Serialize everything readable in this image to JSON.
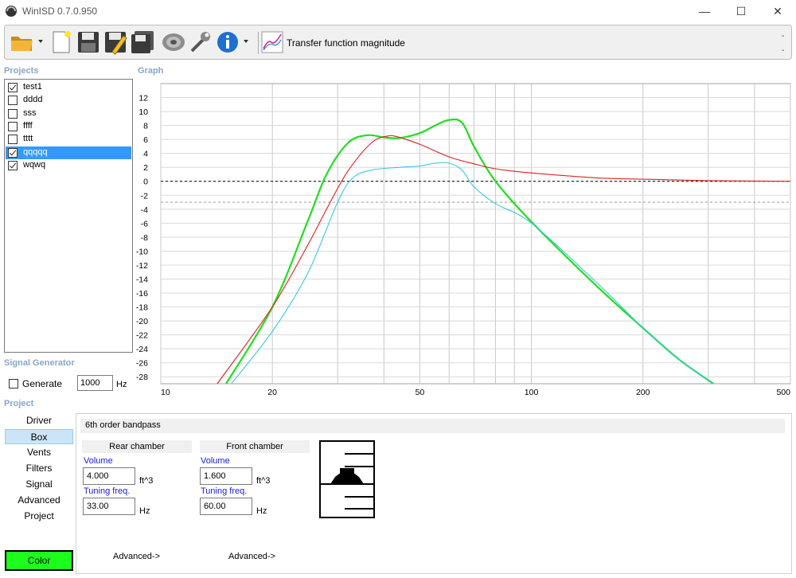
{
  "window": {
    "title": "WinISD 0.7.0.950",
    "min_glyph": "—",
    "max_glyph": "☐",
    "close_glyph": "✕"
  },
  "toolbar": {
    "buttons": [
      "open-folder-icon",
      "new-document-icon",
      "save-icon",
      "save-as-icon",
      "save-all-icon",
      "driver-icon",
      "tools-icon",
      "info-icon",
      "graph-type-icon"
    ],
    "graph_type_label": "Transfer function magnitude",
    "dash_top": "-",
    "dash_bottom": "-"
  },
  "projects": {
    "heading": "Projects",
    "items": [
      {
        "label": "test1",
        "checked": true,
        "selected": false
      },
      {
        "label": "dddd",
        "checked": false,
        "selected": false
      },
      {
        "label": "sss",
        "checked": false,
        "selected": false
      },
      {
        "label": "ffff",
        "checked": false,
        "selected": false
      },
      {
        "label": "tttt",
        "checked": false,
        "selected": false
      },
      {
        "label": "qqqqq",
        "checked": true,
        "selected": true
      },
      {
        "label": "wqwq",
        "checked": true,
        "selected": false
      }
    ]
  },
  "graph": {
    "heading": "Graph"
  },
  "chart_data": {
    "type": "line",
    "title": "Transfer function magnitude",
    "xlabel": "",
    "ylabel": "",
    "x_scale": "log",
    "xlim": [
      10,
      500
    ],
    "ylim": [
      -29,
      14
    ],
    "x_ticks": [
      "10",
      "20",
      "50",
      "100",
      "200",
      "500"
    ],
    "y_ticks": [
      "12",
      "10",
      "8",
      "6",
      "4",
      "2",
      "0",
      "-2",
      "-4",
      "-6",
      "-8",
      "-10",
      "-12",
      "-14",
      "-16",
      "-18",
      "-20",
      "-22",
      "-24",
      "-26",
      "-28"
    ],
    "grid": true,
    "reference_lines": [
      {
        "y": 0,
        "style": "dotted",
        "color": "#000000"
      },
      {
        "y": -3,
        "style": "dotted",
        "color": "#9a9a9a"
      }
    ],
    "series": [
      {
        "color": "#22dd22",
        "points": [
          [
            15,
            -29
          ],
          [
            20,
            -18
          ],
          [
            25,
            -5.5
          ],
          [
            28,
            1
          ],
          [
            32,
            5.5
          ],
          [
            36,
            6.6
          ],
          [
            40,
            6.3
          ],
          [
            44,
            6.2
          ],
          [
            50,
            6.9
          ],
          [
            55,
            8
          ],
          [
            60,
            8.8
          ],
          [
            65,
            8.4
          ],
          [
            70,
            5
          ],
          [
            80,
            0
          ],
          [
            100,
            -5.8
          ],
          [
            150,
            -15
          ],
          [
            200,
            -21
          ],
          [
            250,
            -25.5
          ],
          [
            310,
            -29
          ]
        ]
      },
      {
        "color": "#dd2222",
        "points": [
          [
            14.2,
            -29
          ],
          [
            20,
            -18
          ],
          [
            25,
            -9
          ],
          [
            28,
            -4
          ],
          [
            32,
            1.5
          ],
          [
            37,
            5.5
          ],
          [
            41,
            6.5
          ],
          [
            44,
            6.3
          ],
          [
            50,
            5.3
          ],
          [
            60,
            3.5
          ],
          [
            70,
            2.5
          ],
          [
            80,
            1.8
          ],
          [
            100,
            1.2
          ],
          [
            150,
            0.5
          ],
          [
            200,
            0.3
          ],
          [
            300,
            0.1
          ],
          [
            500,
            0
          ]
        ]
      },
      {
        "color": "#38c8e0",
        "points": [
          [
            15.5,
            -29
          ],
          [
            20,
            -21.5
          ],
          [
            25,
            -13
          ],
          [
            30,
            -3
          ],
          [
            33,
            0.5
          ],
          [
            37,
            1.6
          ],
          [
            44,
            2
          ],
          [
            50,
            2.2
          ],
          [
            55,
            2.6
          ],
          [
            60,
            2.6
          ],
          [
            65,
            1.6
          ],
          [
            70,
            -0.8
          ],
          [
            80,
            -3.2
          ],
          [
            100,
            -6
          ],
          [
            150,
            -14.5
          ],
          [
            200,
            -21
          ],
          [
            250,
            -25.5
          ],
          [
            310,
            -29
          ]
        ]
      }
    ]
  },
  "signal_generator": {
    "heading": "Signal Generator",
    "generate_label": "Generate",
    "checked": false,
    "frequency_value": "1000",
    "frequency_unit": "Hz"
  },
  "project_nav": {
    "heading": "Project",
    "items": [
      "Driver",
      "Box",
      "Vents",
      "Filters",
      "Signal",
      "Advanced",
      "Project"
    ],
    "active": "Box",
    "color_button": "Color",
    "color_value": "#1cff1c"
  },
  "box": {
    "type_label": "6th order bandpass",
    "rear": {
      "heading": "Rear chamber",
      "volume_label": "Volume",
      "volume_value": "4.000",
      "volume_unit": "ft^3",
      "tuning_label": "Tuning freq.",
      "tuning_value": "33.00",
      "tuning_unit": "Hz",
      "advanced": "Advanced->"
    },
    "front": {
      "heading": "Front chamber",
      "volume_label": "Volume",
      "volume_value": "1.600",
      "volume_unit": "ft^3",
      "tuning_label": "Tuning freq.",
      "tuning_value": "60.00",
      "tuning_unit": "Hz",
      "advanced": "Advanced->"
    }
  }
}
